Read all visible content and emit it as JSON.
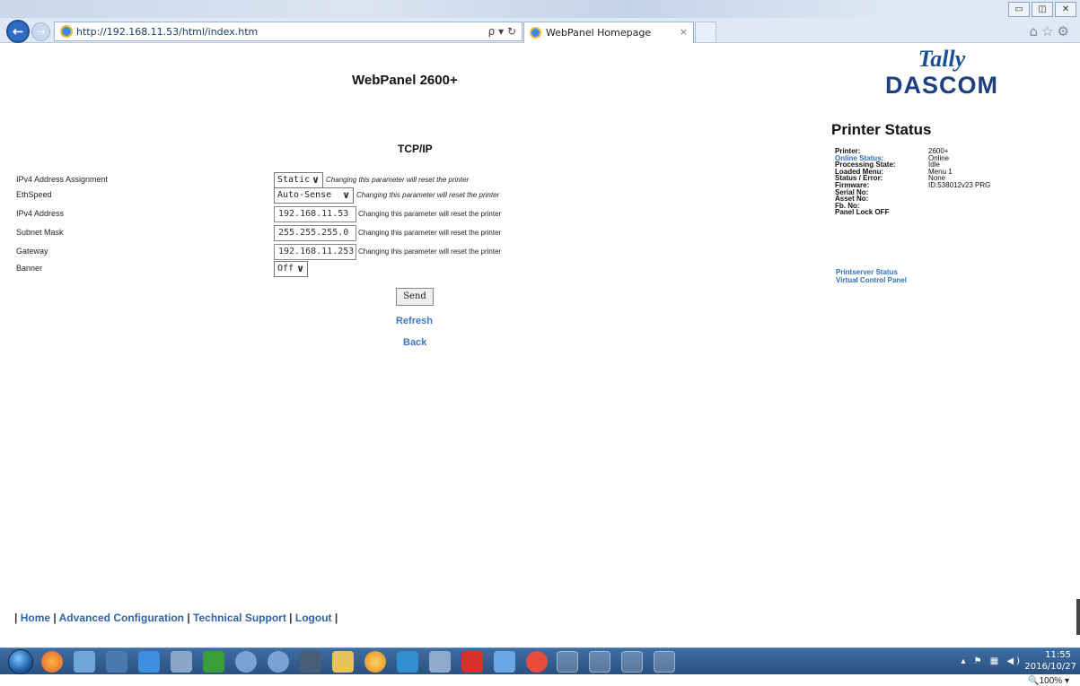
{
  "browser": {
    "url": "http://192.168.11.53/html/index.htm",
    "address_tools": "ρ ▾ ↻",
    "tab_title": "WebPanel Homepage",
    "tab_close": "×",
    "nav_back": "←",
    "nav_forward": "→",
    "window_controls": [
      "▭",
      "◫",
      "✕"
    ],
    "chrome_icons": "⌂☆⚙"
  },
  "page": {
    "title": "WebPanel 2600+",
    "logo_top": "Tally",
    "logo_bottom": "DASCOM",
    "section": "TCP/IP",
    "fields": [
      {
        "label": "IPv4 Address Assignment",
        "value": "Static",
        "type": "select",
        "hint": "Changing this parameter will reset the printer"
      },
      {
        "label": "EthSpeed",
        "value": "Auto-Sense",
        "type": "select",
        "hint": "Changing this parameter will reset the printer"
      },
      {
        "label": "IPv4 Address",
        "value": "192.168.11.53",
        "type": "text",
        "hint": "Changing this parameter will reset the printer"
      },
      {
        "label": "Subnet Mask",
        "value": "255.255.255.0",
        "type": "text",
        "hint": "Changing this parameter will reset the printer"
      },
      {
        "label": "Gateway",
        "value": "192.168.11.253",
        "type": "text",
        "hint": "Changing this parameter will reset the printer"
      },
      {
        "label": "Banner",
        "value": "Off",
        "type": "select",
        "hint": ""
      }
    ],
    "send_label": "Send",
    "refresh_label": "Refresh",
    "back_label": "Back"
  },
  "status": {
    "heading": "Printer Status",
    "rows": [
      {
        "key": "Printer:",
        "value": "2600+"
      },
      {
        "key": "Online Status:",
        "value": "Online"
      },
      {
        "key": "Processing State:",
        "value": "Idle"
      },
      {
        "key": "Loaded Menu:",
        "value": "Menu 1"
      },
      {
        "key": "Status / Error:",
        "value": "None"
      },
      {
        "key": "Firmware:",
        "value": "ID:538012v23 PRG"
      },
      {
        "key": "Serial No:",
        "value": ""
      },
      {
        "key": "Asset No:",
        "value": ""
      },
      {
        "key": "Fb. No:",
        "value": ""
      },
      {
        "key": "Panel Lock OFF",
        "value": ""
      }
    ],
    "printserver_link": "Printserver Status",
    "vcp_link": "Virtual Control Panel"
  },
  "footer": {
    "sep": "|",
    "links": [
      "Home",
      "Advanced Configuration",
      "Technical Support",
      "Logout"
    ]
  },
  "zoom": "🔍100%  ▾",
  "taskbar": {
    "tray": "▴ ⚑ ▦ ◀)",
    "time": "11:55",
    "date": "2016/10/27"
  },
  "colors": {
    "link": "#2f6fc0",
    "logo": "#1d4f96",
    "taskbar": "#2a517f"
  }
}
